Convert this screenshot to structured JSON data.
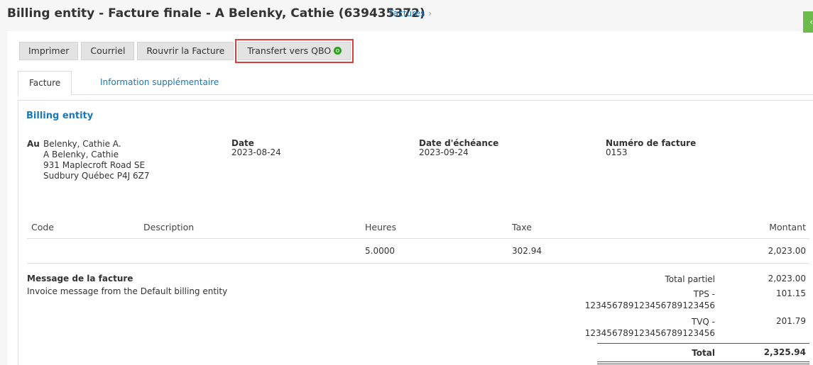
{
  "header": {
    "title": "Billing entity - Facture finale - A Belenky, Cathie (639435372)",
    "breadcrumb": "Factures",
    "breadcrumb_chevron": "›"
  },
  "toolbar": {
    "print_label": "Imprimer",
    "email_label": "Courriel",
    "reopen_label": "Rouvrir la Facture",
    "transfer_label": "Transfert vers QBO"
  },
  "tabs": {
    "invoice": "Facture",
    "additional_info": "Information supplémentaire"
  },
  "invoice": {
    "entity": "Billing entity",
    "to_label": "Au",
    "address": [
      "Belenky, Cathie A.",
      "A Belenky, Cathie",
      "931 Maplecroft Road SE",
      "Sudbury Québec P4J 6Z7"
    ],
    "date_label": "Date",
    "date_value": "2023-08-24",
    "due_label": "Date d'échéance",
    "due_value": "2023-09-24",
    "number_label": "Numéro de facture",
    "number_value": "0153"
  },
  "table": {
    "headers": {
      "code": "Code",
      "description": "Description",
      "hours": "Heures",
      "tax": "Taxe",
      "amount": "Montant"
    },
    "row": {
      "code": "",
      "description": "",
      "hours": "5.0000",
      "tax": "302.94",
      "amount": "2,023.00"
    }
  },
  "message": {
    "title": "Message de la facture",
    "text": "Invoice message from the Default billing entity"
  },
  "totals": {
    "subtotal_label": "Total partiel",
    "subtotal_value": "2,023.00",
    "tps_label": "TPS -",
    "tps_number": "12345678912345678912345​6",
    "tps_value": "101.15",
    "tvq_label": "TVQ -",
    "tvq_number": "123456789123456789123456",
    "tvq_value": "201.79",
    "total_label": "Total",
    "total_value": "2,325.94"
  }
}
